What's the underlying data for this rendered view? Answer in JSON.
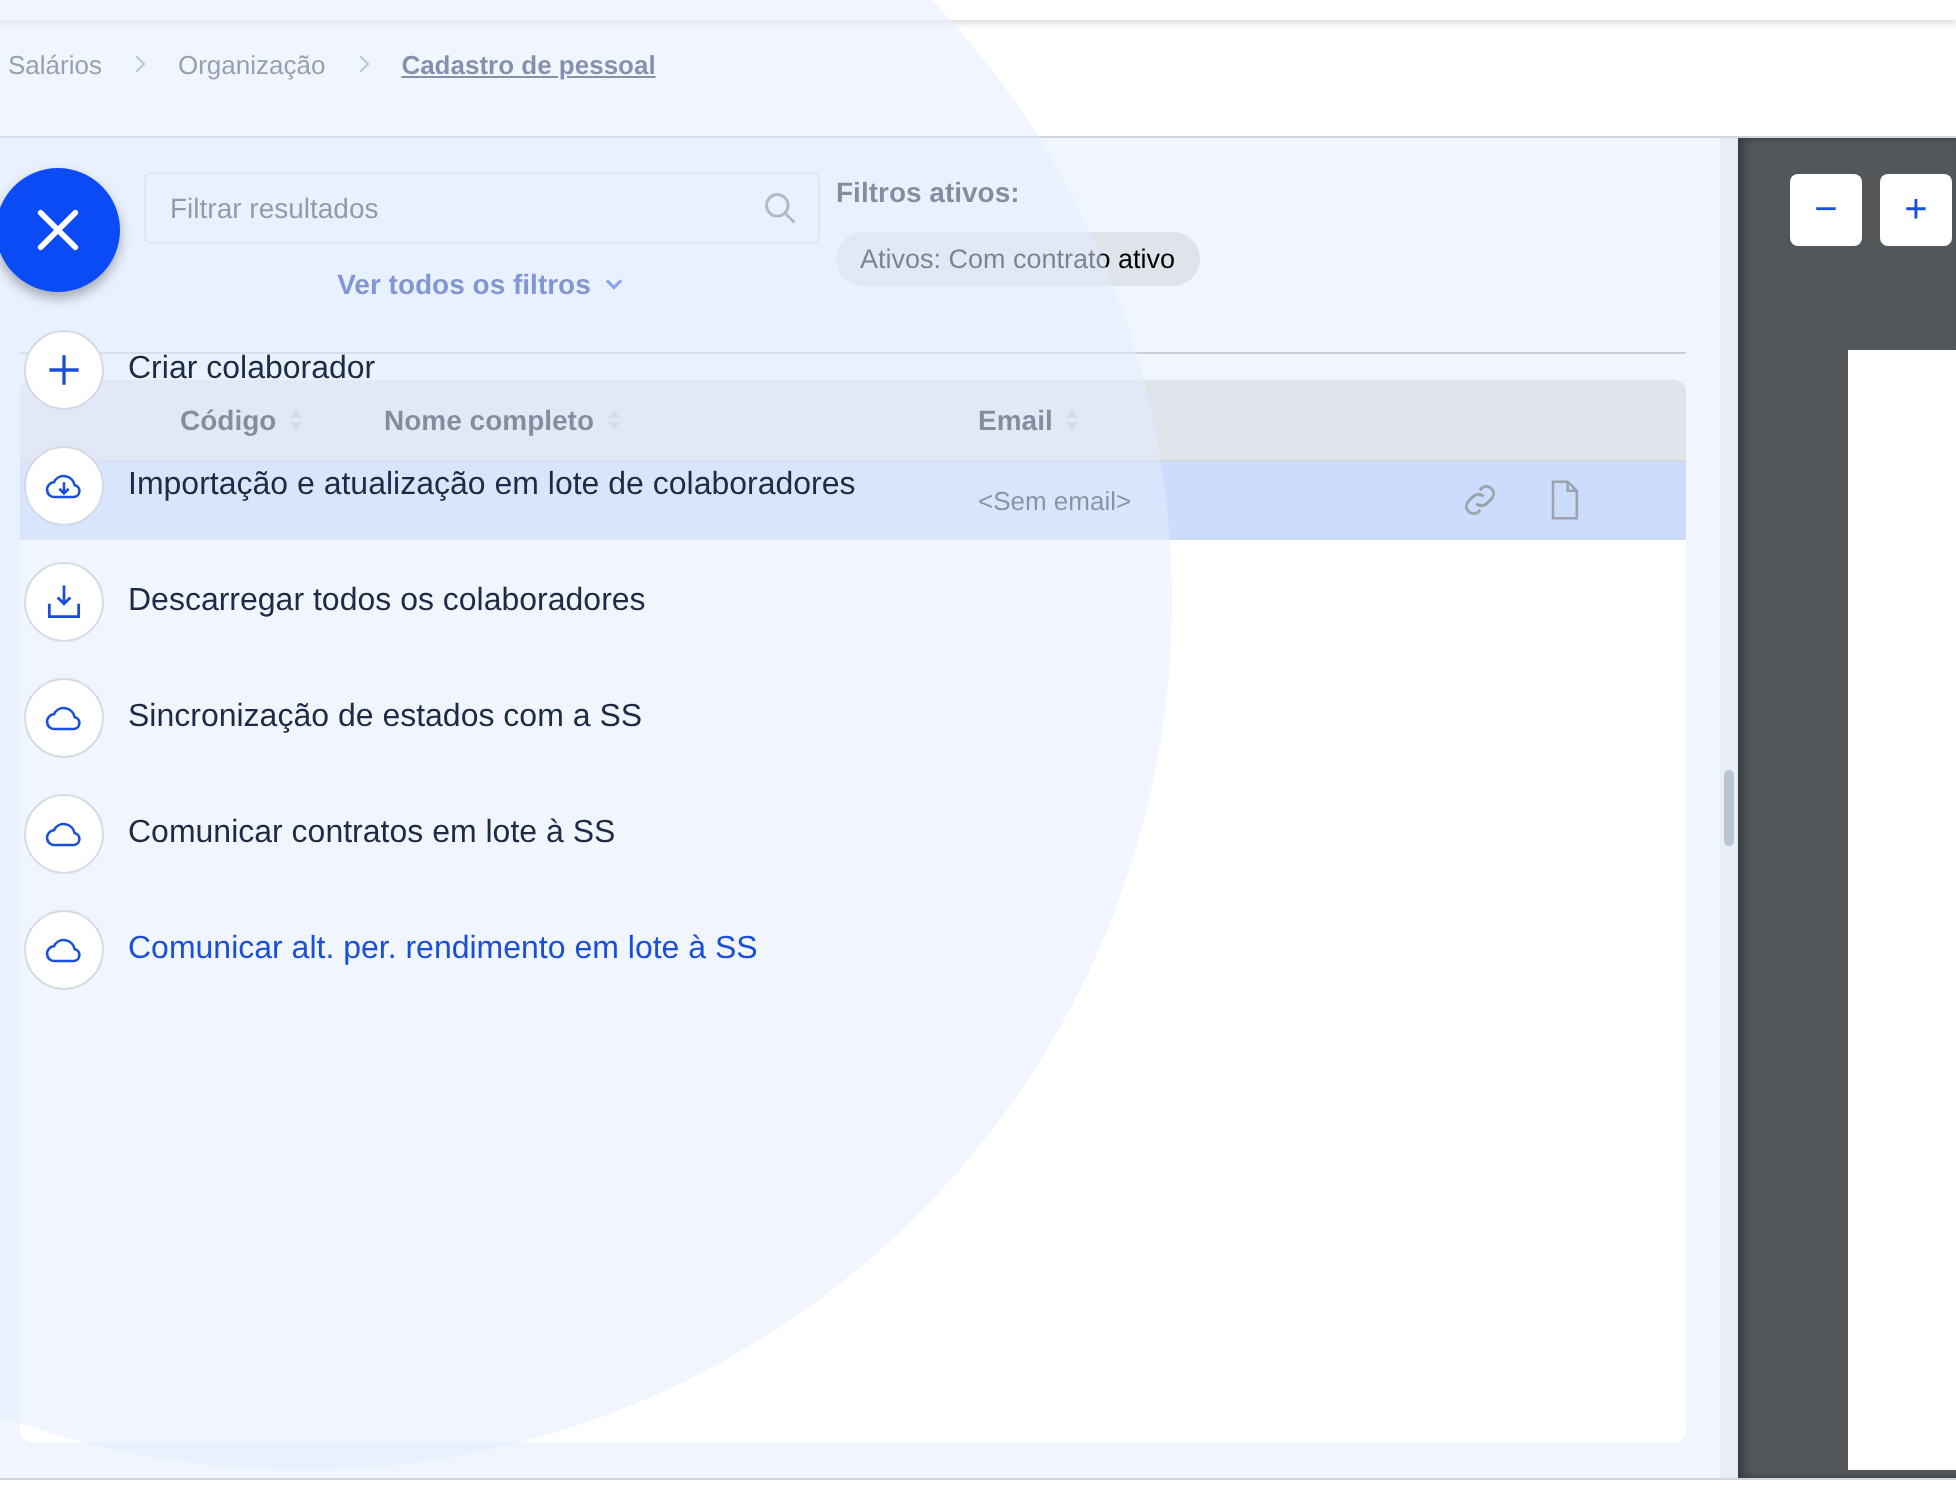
{
  "breadcrumb": [
    {
      "label": "Salários",
      "current": false
    },
    {
      "label": "Organização",
      "current": false
    },
    {
      "label": "Cadastro de pessoal",
      "current": true
    }
  ],
  "search": {
    "placeholder": "Filtrar resultados"
  },
  "filters_link": "Ver todos os filtros",
  "active_filters": {
    "title": "Filtros ativos:",
    "chips": [
      "Ativos: Com contrato ativo"
    ]
  },
  "table": {
    "columns": [
      "Código",
      "Nome completo",
      "Email"
    ],
    "rows": [
      {
        "email": "<Sem email>",
        "selected": true
      }
    ]
  },
  "viewer": {
    "zoom_out": "−",
    "zoom_in": "+"
  },
  "menu": {
    "items": [
      {
        "kind": "create",
        "label": "Criar colaborador",
        "selected": false
      },
      {
        "kind": "import",
        "label": "Importação e atualização em lote de colaboradores",
        "selected": false
      },
      {
        "kind": "export",
        "label": "Descarregar todos os colaboradores",
        "selected": false
      },
      {
        "kind": "sync",
        "label": "Sincronização de estados com a SS",
        "selected": false
      },
      {
        "kind": "sync",
        "label": "Comunicar contratos em lote à SS",
        "selected": false
      },
      {
        "kind": "sync",
        "label": "Comunicar alt. per. rendimento em lote à SS",
        "selected": true
      }
    ]
  }
}
